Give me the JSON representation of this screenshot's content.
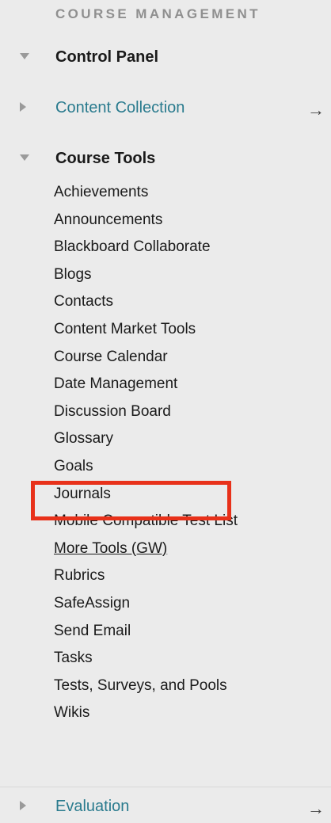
{
  "section": {
    "title": "COURSE MANAGEMENT"
  },
  "control_panel": {
    "label": "Control Panel",
    "icon": "triangle-down-icon"
  },
  "content_collection": {
    "label": "Content Collection",
    "arrow": "→",
    "icon": "triangle-right-icon"
  },
  "course_tools": {
    "label": "Course Tools",
    "icon": "triangle-down-icon",
    "items": [
      "Achievements",
      "Announcements",
      "Blackboard Collaborate",
      "Blogs",
      "Contacts",
      "Content Market Tools",
      "Course Calendar",
      "Date Management",
      "Discussion Board",
      "Glossary",
      "Goals",
      "Journals",
      "Mobile Compatible Test List",
      "More Tools (GW)",
      "Rubrics",
      "SafeAssign",
      "Send Email",
      "Tasks",
      "Tests, Surveys, and Pools",
      "Wikis"
    ],
    "selected": "More Tools (GW)"
  },
  "evaluation": {
    "label": "Evaluation",
    "arrow": "→",
    "icon": "triangle-right-icon"
  },
  "colors": {
    "background": "#ebebeb",
    "link": "#2a7b8e",
    "highlight": "#e8311a"
  }
}
